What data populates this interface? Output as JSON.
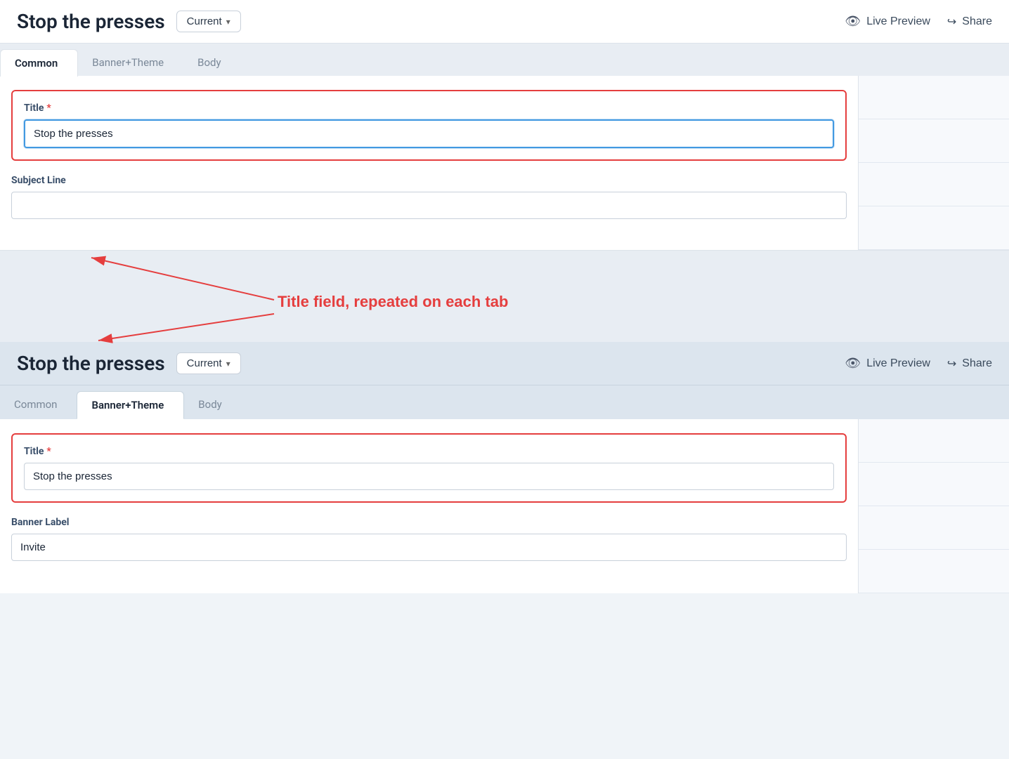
{
  "panels": [
    {
      "id": "top",
      "title": "Stop the presses",
      "version_dropdown": "Current",
      "live_preview_label": "Live Preview",
      "share_label": "Share",
      "tabs": [
        {
          "id": "common",
          "label": "Common",
          "active": true
        },
        {
          "id": "banner-theme",
          "label": "Banner+Theme",
          "active": false
        },
        {
          "id": "body",
          "label": "Body",
          "active": false
        }
      ],
      "fields": [
        {
          "id": "title",
          "label": "Title",
          "required": true,
          "value": "Stop the presses",
          "focused": true
        },
        {
          "id": "subject-line",
          "label": "Subject Line",
          "required": false,
          "value": "",
          "focused": false
        }
      ]
    },
    {
      "id": "bottom",
      "title": "Stop the presses",
      "version_dropdown": "Current",
      "live_preview_label": "Live Preview",
      "share_label": "Share",
      "tabs": [
        {
          "id": "common",
          "label": "Common",
          "active": false
        },
        {
          "id": "banner-theme",
          "label": "Banner+Theme",
          "active": true
        },
        {
          "id": "body",
          "label": "Body",
          "active": false
        }
      ],
      "fields": [
        {
          "id": "title",
          "label": "Title",
          "required": true,
          "value": "Stop the presses",
          "focused": false
        },
        {
          "id": "banner-label",
          "label": "Banner Label",
          "required": false,
          "value": "Invite",
          "focused": false
        }
      ]
    }
  ],
  "annotation": {
    "text": "Title field, repeated on each tab"
  }
}
